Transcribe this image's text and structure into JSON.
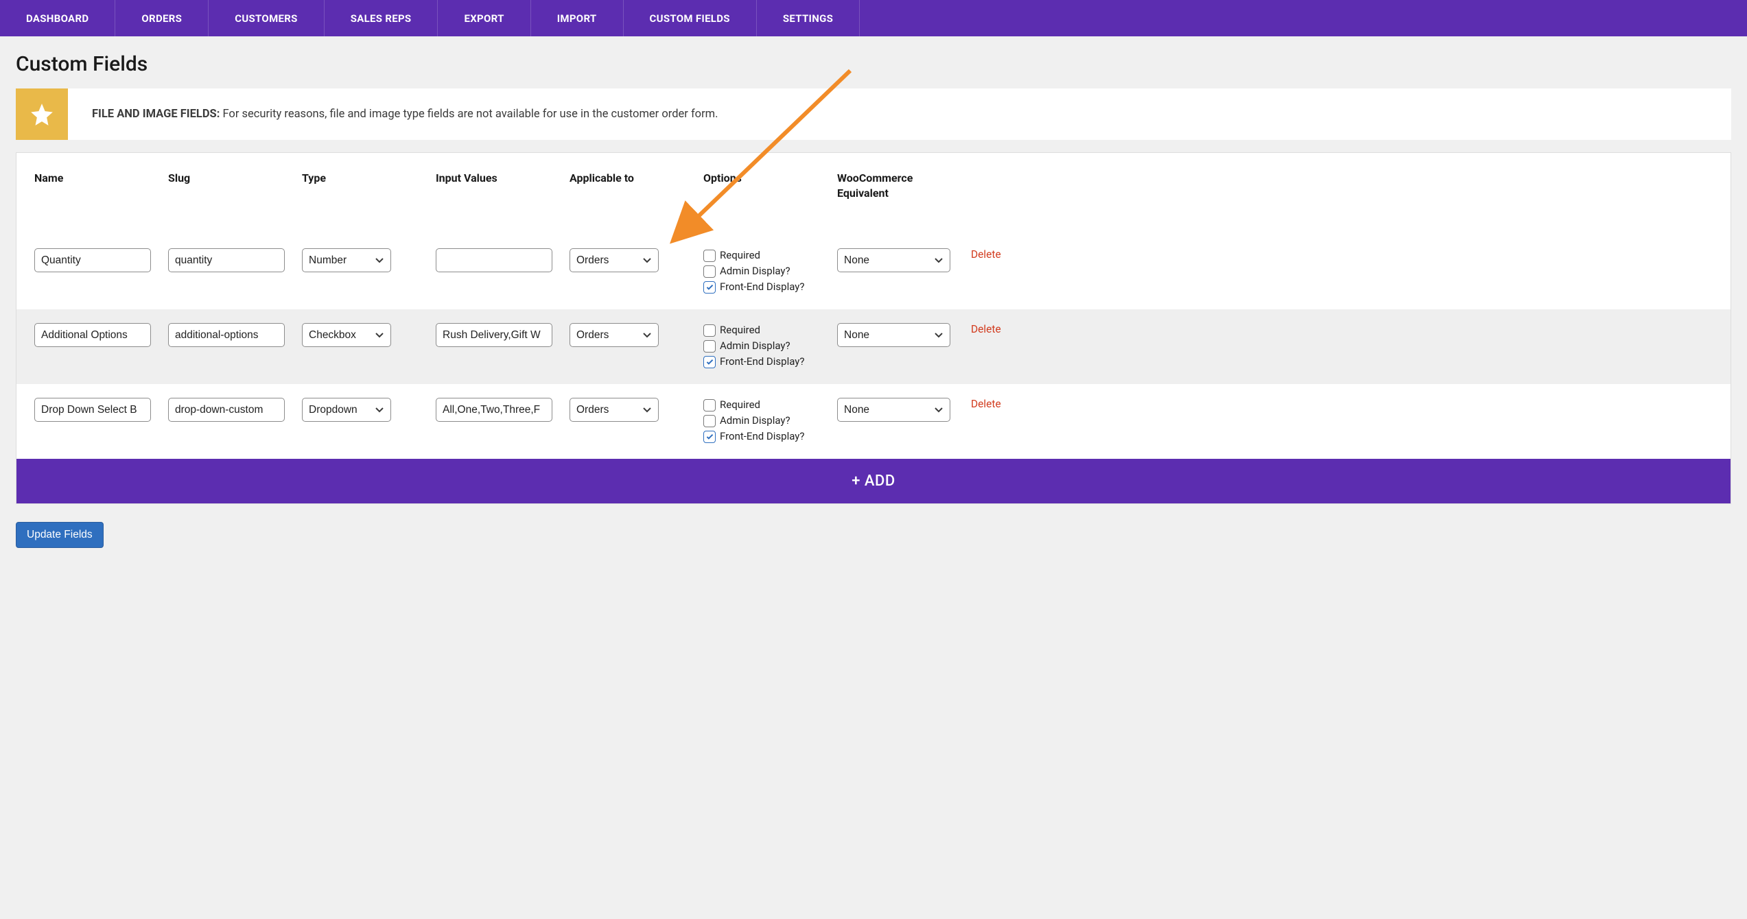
{
  "nav": {
    "items": [
      {
        "label": "DASHBOARD"
      },
      {
        "label": "ORDERS"
      },
      {
        "label": "CUSTOMERS"
      },
      {
        "label": "SALES REPS"
      },
      {
        "label": "EXPORT"
      },
      {
        "label": "IMPORT"
      },
      {
        "label": "CUSTOM FIELDS"
      },
      {
        "label": "SETTINGS"
      }
    ]
  },
  "page": {
    "title": "Custom Fields"
  },
  "notice": {
    "heading": "FILE AND IMAGE FIELDS:",
    "body": " For security reasons, file and image type fields are not available for use in the customer order form."
  },
  "table": {
    "headers": {
      "name": "Name",
      "slug": "Slug",
      "type": "Type",
      "input_values": "Input Values",
      "applicable_to": "Applicable to",
      "options": "Options",
      "wc_equiv": "WooCommerce Equivalent"
    },
    "option_labels": {
      "required": "Required",
      "admin_display": "Admin Display?",
      "frontend_display": "Front-End Display?"
    },
    "delete_label": "Delete",
    "rows": [
      {
        "name": "Quantity",
        "slug": "quantity",
        "type": "Number",
        "input_values": "",
        "applicable_to": "Orders",
        "options": {
          "required": false,
          "admin_display": false,
          "frontend_display": true
        },
        "wc_equiv": "None"
      },
      {
        "name": "Additional Options",
        "slug": "additional-options",
        "type": "Checkbox",
        "input_values": "Rush Delivery,Gift W",
        "applicable_to": "Orders",
        "options": {
          "required": false,
          "admin_display": false,
          "frontend_display": true
        },
        "wc_equiv": "None"
      },
      {
        "name": "Drop Down Select B",
        "slug": "drop-down-custom",
        "type": "Dropdown",
        "input_values": "All,One,Two,Three,F",
        "applicable_to": "Orders",
        "options": {
          "required": false,
          "admin_display": false,
          "frontend_display": true
        },
        "wc_equiv": "None"
      }
    ]
  },
  "buttons": {
    "add": "+ ADD",
    "update": "Update Fields"
  },
  "colors": {
    "brand_purple": "#5c2db0",
    "accent_blue": "#2f6fbf",
    "danger_red": "#d23c1f",
    "notice_star": "#e9b949",
    "arrow_orange": "#f28c28"
  }
}
